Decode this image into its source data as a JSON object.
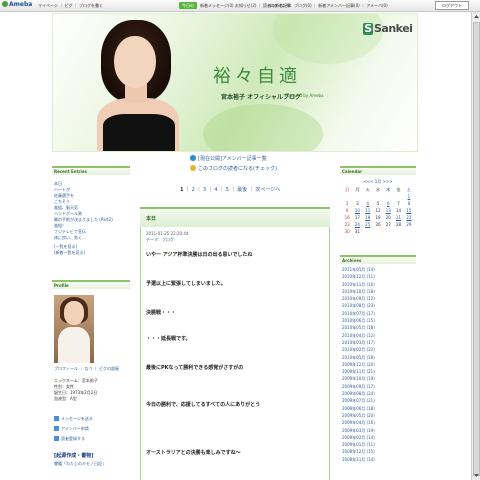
{
  "topbar": {
    "logo": "Ameba",
    "nav": "マイページ ｜ ピグ ｜ ブログを書く",
    "green_badge": "今日の",
    "messages": "新着メッセージ(0)  お知らせ(2) ｜ 読者の新着記事",
    "right": "ログイン中：ブログ(0) ｜ 新着アメンバー記事(0) ｜ アメーバ(0)",
    "logout": "ログアウト"
  },
  "header": {
    "brand": "Sankei",
    "title": "裕々自適",
    "subtitle": "宮本裕子 オフィシャルブログ",
    "powered": "Powered by Ameba",
    "colors": {
      "title": "#3a8a3a",
      "accent": "#8cc46c"
    }
  },
  "notices": {
    "line1": "[現在公開]アメンバー記事一覧",
    "line2": "このブログの読者になる(チェック)"
  },
  "pager": {
    "pages": [
      "1",
      "2",
      "3",
      "4",
      "5"
    ],
    "last": "最後",
    "next": "次ページへ"
  },
  "left": {
    "recent_title": "Recent Entries",
    "recent_items": [
      "本日",
      "ハートが",
      "佐藤選手を",
      "ごちそう",
      "嵐組、脳天気",
      "ハンドボール熱",
      "脚の手術が決まりました (Part2)",
      "嵐組！",
      "フジテレビで宣伝",
      "体に良い、効く…",
      "[一覧を見る]",
      "[新着一覧を見る]"
    ],
    "profile_title": "Profile",
    "profile_links": "プロフィール ｜ なう ｜ ピグの部屋",
    "profile_info": [
      "ニックネーム：宮本裕子",
      "性別：女性",
      "誕生日：1973年2月2日",
      "血液型：A型"
    ],
    "actions": [
      "メッセージを送る",
      "アメンバー申請",
      "読者登録する"
    ],
    "books_title": "[起源作成・書物]",
    "books_sub": "書籍「わたしのキモノ日記」"
  },
  "article": {
    "title": "本日",
    "date": "2011-01-25 22:20:44",
    "theme": "テーマ：ブログ",
    "lines": [
      "いやー アジア杯準決勝は日の出る思いでしたね",
      "予選以上に緊張してしまいました。",
      "決勝戦・・・",
      "・・・延長戦です。",
      "最後にPKなって勝利できる感覚がさすがの",
      "今日の勝利で、応援してるすべての人にありがとう",
      "オーストラリアとの決勝も楽しみですね～"
    ]
  },
  "calendar": {
    "title": "Calendar",
    "month_nav": "<<< 1月 >>>",
    "weekdays": [
      "日",
      "月",
      "火",
      "水",
      "木",
      "金",
      "土"
    ],
    "weeks": [
      [
        "",
        "",
        "",
        "",
        "",
        "",
        "1"
      ],
      [
        "2",
        "3",
        "4",
        "5",
        "6",
        "7",
        "8"
      ],
      [
        "9",
        "10",
        "11",
        "12",
        "13",
        "14",
        "15"
      ],
      [
        "16",
        "17",
        "18",
        "19",
        "20",
        "21",
        "22"
      ],
      [
        "23",
        "24",
        "25",
        "26",
        "27",
        "28",
        "29"
      ],
      [
        "30",
        "31",
        "",
        "",
        "",
        "",
        ""
      ]
    ]
  },
  "archives": {
    "title": "Archives",
    "items": [
      "2011年01月 (14)",
      "2010年12月 (11)",
      "2010年11月 (16)",
      "2010年10月 (18)",
      "2010年09月 (12)",
      "2010年08月 (23)",
      "2010年07月 (17)",
      "2010年06月 (15)",
      "2010年05月 (18)",
      "2010年04月 (12)",
      "2010年03月 (17)",
      "2010年02月 (22)",
      "2010年01月 (18)",
      "2009年12月 (20)",
      "2009年11月 (21)",
      "2009年10月 (19)",
      "2009年09月 (17)",
      "2009年08月 (24)",
      "2009年07月 (21)",
      "2009年06月 (18)",
      "2009年05月 (20)",
      "2009年04月 (16)",
      "2009年03月 (19)",
      "2009年02月 (14)",
      "2009年01月 (11)",
      "2008年12月 (15)",
      "2008年11月 (14)"
    ]
  }
}
